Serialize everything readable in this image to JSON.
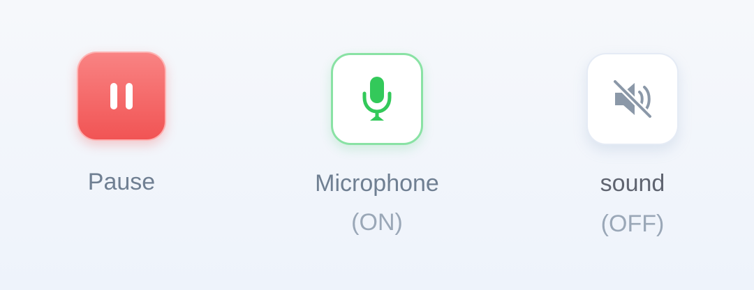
{
  "controls": {
    "pause": {
      "label": "Pause",
      "icon": "pause-icon",
      "color": "#f15454"
    },
    "microphone": {
      "label": "Microphone",
      "state": "(ON)",
      "icon": "microphone-icon",
      "color": "#33c95a"
    },
    "sound": {
      "label": "sound",
      "state": "(OFF)",
      "icon": "speaker-muted-icon",
      "color": "#8b98a8"
    }
  }
}
